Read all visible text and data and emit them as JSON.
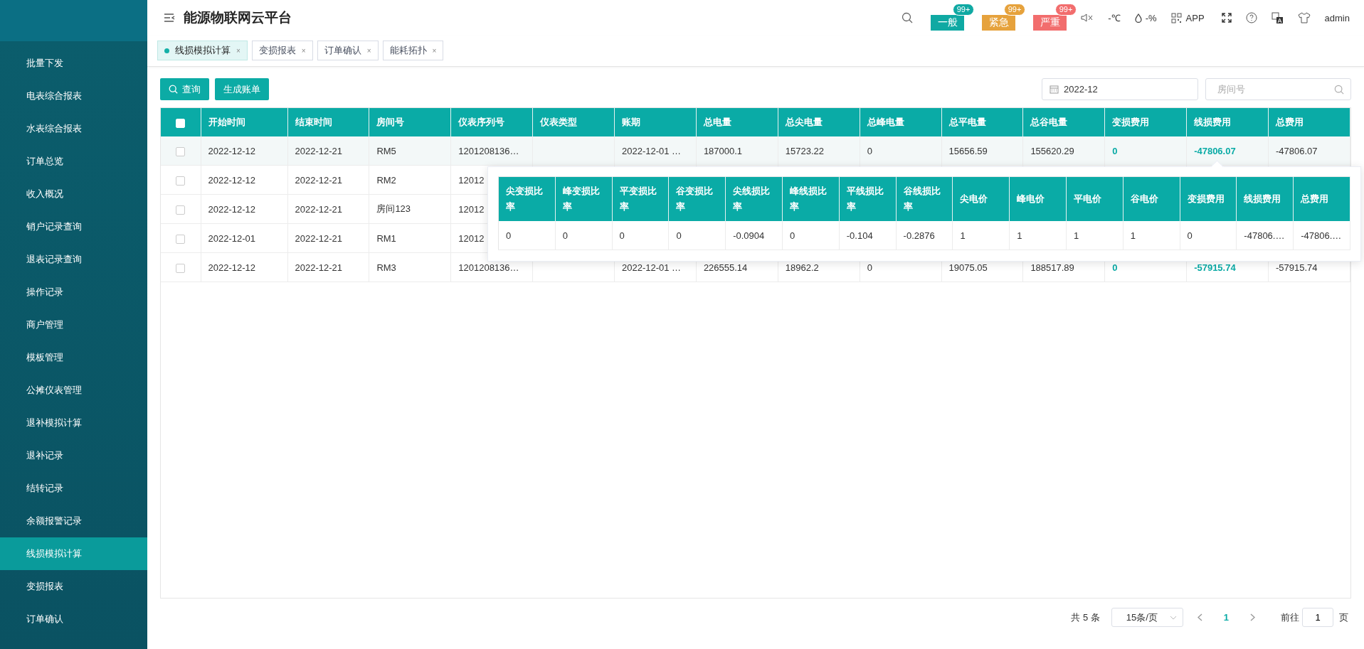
{
  "sidebar": {
    "items": [
      {
        "label": "批量下发",
        "selected": false
      },
      {
        "label": "电表综合报表",
        "selected": false
      },
      {
        "label": "水表综合报表",
        "selected": false
      },
      {
        "label": "订单总览",
        "selected": false
      },
      {
        "label": "收入概况",
        "selected": false
      },
      {
        "label": "销户记录查询",
        "selected": false
      },
      {
        "label": "退表记录查询",
        "selected": false
      },
      {
        "label": "操作记录",
        "selected": false
      },
      {
        "label": "商户管理",
        "selected": false
      },
      {
        "label": "模板管理",
        "selected": false
      },
      {
        "label": "公摊仪表管理",
        "selected": false
      },
      {
        "label": "退补模拟计算",
        "selected": false
      },
      {
        "label": "退补记录",
        "selected": false
      },
      {
        "label": "结转记录",
        "selected": false
      },
      {
        "label": "余额报警记录",
        "selected": false
      },
      {
        "label": "线损模拟计算",
        "selected": true
      },
      {
        "label": "变损报表",
        "selected": false
      },
      {
        "label": "订单确认",
        "selected": false
      }
    ]
  },
  "header": {
    "title": "能源物联网云平台",
    "badges": [
      {
        "label": "一般",
        "count": "99+",
        "color": "#0fa9a3"
      },
      {
        "label": "紧急",
        "count": "99+",
        "color": "#e6a23c"
      },
      {
        "label": "严重",
        "count": "99+",
        "color": "#f26d6d"
      }
    ],
    "temperature": "-℃",
    "humidity": "-%",
    "app_label": "APP",
    "user": "admin"
  },
  "tabs": [
    {
      "label": "线损模拟计算",
      "selected": true,
      "close": "×"
    },
    {
      "label": "变损报表",
      "selected": false,
      "close": "×"
    },
    {
      "label": "订单确认",
      "selected": false,
      "close": "×"
    },
    {
      "label": "能耗拓扑",
      "selected": false,
      "close": "×"
    }
  ],
  "toolbar": {
    "buttons": [
      {
        "label": "查询",
        "kind": "search"
      },
      {
        "label": "生成账单",
        "kind": "plain"
      }
    ],
    "month_field": {
      "value": "2022-12"
    },
    "room_field": {
      "placeholder": "房间号"
    }
  },
  "table": {
    "header_checked": false,
    "columns": [
      "开始时间",
      "结束时间",
      "房间号",
      "仪表序列号",
      "仪表类型",
      "账期",
      "总电量",
      "总尖电量",
      "总峰电量",
      "总平电量",
      "总谷电量",
      "变损费用",
      "线损费用",
      "总费用"
    ],
    "rows": [
      {
        "checked": false,
        "hovered": true,
        "cells": [
          "2022-12-12",
          "2022-12-21",
          "RM5",
          "1201208136…",
          "",
          "2022-12-01 …",
          "187000.1",
          "15723.22",
          "0",
          "15656.59",
          "155620.29",
          {
            "text": "0",
            "accent": true
          },
          {
            "text": "-47806.07",
            "accent": true
          },
          "-47806.07"
        ]
      },
      {
        "checked": false,
        "hovered": false,
        "cells": [
          "2022-12-12",
          "2022-12-21",
          "RM2",
          "12012"
        ]
      },
      {
        "checked": false,
        "hovered": false,
        "cells": [
          "2022-12-12",
          "2022-12-21",
          "房间123",
          "12012"
        ]
      },
      {
        "checked": false,
        "hovered": false,
        "cells": [
          "2022-12-01",
          "2022-12-21",
          "RM1",
          "12012"
        ]
      },
      {
        "checked": false,
        "hovered": false,
        "cells": [
          "2022-12-12",
          "2022-12-21",
          "RM3",
          "1201208136…",
          "",
          "2022-12-01 …",
          "226555.14",
          "18962.2",
          "0",
          "19075.05",
          "188517.89",
          {
            "text": "0",
            "accent": true
          },
          {
            "text": "-57915.74",
            "accent": true
          },
          "-57915.74"
        ]
      }
    ]
  },
  "popup": {
    "columns": [
      "尖变损比率",
      "峰变损比率",
      "平变损比率",
      "谷变损比率",
      "尖线损比率",
      "峰线损比率",
      "平线损比率",
      "谷线损比率",
      "尖电价",
      "峰电价",
      "平电价",
      "谷电价",
      "变损费用",
      "线损费用",
      "总费用"
    ],
    "rows": [
      [
        "0",
        "0",
        "0",
        "0",
        "-0.0904",
        "0",
        "-0.104",
        "-0.2876",
        "1",
        "1",
        "1",
        "1",
        "0",
        "-47806.…",
        "-47806.…"
      ]
    ]
  },
  "pagination": {
    "total": "共 5 条",
    "page_size": "15条/页",
    "current": "1",
    "goto_label": "前往",
    "goto_value": "1",
    "page_unit": "页"
  }
}
